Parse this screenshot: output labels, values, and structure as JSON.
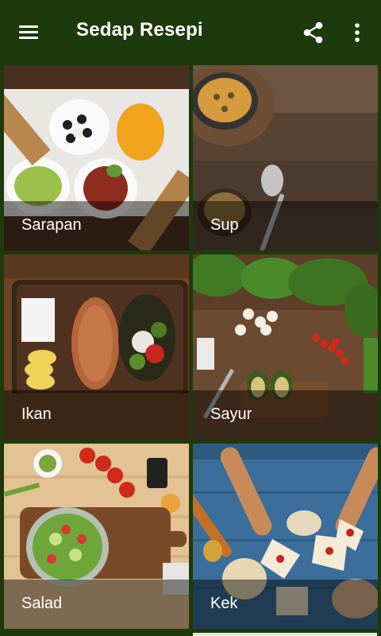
{
  "app": {
    "title": "Sedap Resepi",
    "menu_icon": "hamburger-menu-icon",
    "share_icon": "share-icon",
    "more_icon": "more-vertical-icon",
    "bar_color": "#1d3a0c"
  },
  "categories": [
    {
      "label": "Sarapan"
    },
    {
      "label": "Sup"
    },
    {
      "label": "Ikan"
    },
    {
      "label": "Sayur"
    },
    {
      "label": "Salad"
    },
    {
      "label": "Kek"
    }
  ]
}
